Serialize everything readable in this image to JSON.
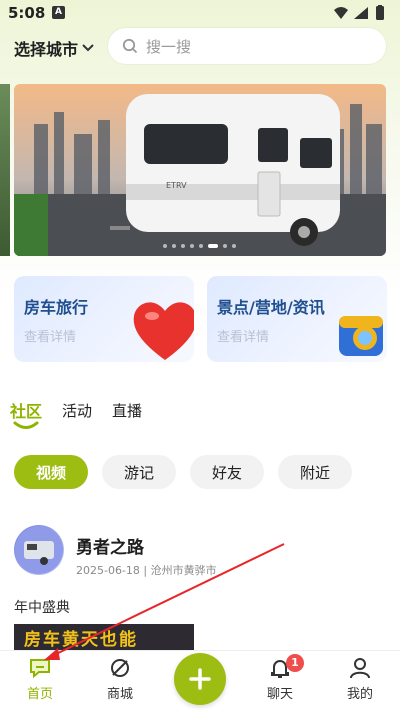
{
  "status_bar": {
    "time": "5:08",
    "notification": "A"
  },
  "header": {
    "city_label": "选择城市",
    "search_placeholder": "搜一搜"
  },
  "banner": {
    "caption": "ETRV",
    "slides": 8,
    "active_slide": 5
  },
  "feature_cards": [
    {
      "title": "房车旅行",
      "subtitle": "查看详情"
    },
    {
      "title": "景点/营地/资讯",
      "subtitle": "查看详情"
    }
  ],
  "tabs": [
    {
      "label": "社区",
      "active": true
    },
    {
      "label": "活动",
      "active": false
    },
    {
      "label": "直播",
      "active": false
    }
  ],
  "filters": [
    {
      "label": "视频",
      "active": true
    },
    {
      "label": "游记",
      "active": false
    },
    {
      "label": "好友",
      "active": false
    },
    {
      "label": "附近",
      "active": false
    }
  ],
  "post": {
    "author": "勇者之路",
    "date": "2025-06-18",
    "location": "沧州市黄骅市",
    "meta": "2025-06-18 | 沧州市黄骅市",
    "title": "年中盛典",
    "thumb_text": "房车黄天也能"
  },
  "bottom_nav": {
    "items": [
      {
        "label": "首页",
        "icon": "home-chat-icon",
        "active": true
      },
      {
        "label": "商城",
        "icon": "mall-icon",
        "active": false
      },
      {
        "label": "聊天",
        "icon": "bell-icon",
        "active": false,
        "badge": "1"
      },
      {
        "label": "我的",
        "icon": "person-icon",
        "active": false
      }
    ],
    "fab_icon": "plus-icon"
  },
  "colors": {
    "accent": "#9dbd12",
    "card_title": "#1f4f8f",
    "badge": "#f04d4d",
    "annotation_arrow": "#e8262a"
  }
}
